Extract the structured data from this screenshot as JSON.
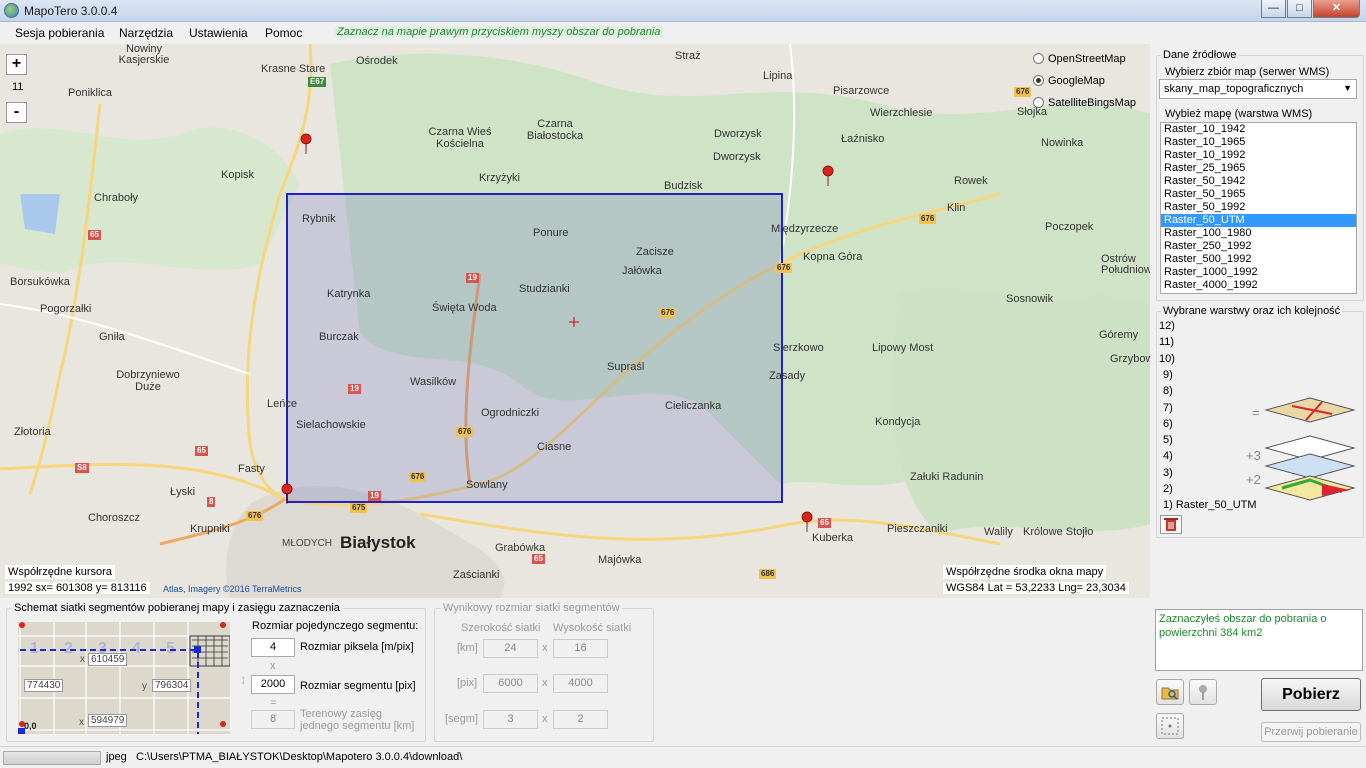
{
  "window": {
    "title": "MapoTero 3.0.0.4",
    "buttons": {
      "minimize": "—",
      "maximize": "□",
      "close": "✕"
    }
  },
  "menu": {
    "items": [
      "Sesja pobierania",
      "Narzędzia",
      "Ustawienia",
      "Pomoc"
    ],
    "hint": "Zaznacz na mapie  prawym  przyciskiem myszy obszar do pobrania"
  },
  "map": {
    "zoom_in": "+",
    "zoom_out": "-",
    "zoom_level": "11",
    "sources": [
      {
        "label": "OpenStreetMap",
        "selected": false
      },
      {
        "label": "GoogleMap",
        "selected": true
      },
      {
        "label": "SatelliteBingsMap",
        "selected": false
      }
    ],
    "places": [
      "Krasne Stare",
      "Ośrodek",
      "Straż",
      "Lipina",
      "Nowiny Kasjerskie",
      "Poniklica",
      "Czarna Wieś Kościelna",
      "Czarna Białostocka",
      "Dworzysk",
      "Dworzysk",
      "Pisarzowce",
      "Wierzchlesie",
      "Łaźnisko",
      "Nowinka",
      "Słojka",
      "Kopisk",
      "Krzyżyki",
      "Budzisk",
      "Rowek",
      "Chraboły",
      "Rybnik",
      "Ponure",
      "Zacisze",
      "Jałówka",
      "Międzyrzecze",
      "Klin",
      "Poczopek",
      "Borsukówka",
      "Katrynka",
      "Święta Woda",
      "Studzianki",
      "Kopna Góra",
      "Ostrów Południowy",
      "Pogorzałki",
      "Burczak",
      "Sosnowik",
      "Gniła",
      "Supraśl",
      "Sierzkowo",
      "Lipowy Most",
      "Góremy",
      "Grzybowe",
      "Dobrzyniewo Duże",
      "Wasilków",
      "Zasady",
      "Cieliczanka",
      "Leńce",
      "Ogrodniczki",
      "Kondycja",
      "Złotoria",
      "Sielachowskie",
      "Ciasne",
      "Fasty",
      "Sowlany",
      "Załuki Radunin",
      "Łyski",
      "Choroszcz",
      "Krupniki",
      "Pieszczaniki",
      "Walily",
      "Królowe Stojło",
      "Kuberka",
      "Grabówka",
      "Majówka",
      "Zaścianki"
    ],
    "city": "Białystok",
    "district": "MŁODYCH",
    "roads": [
      "E67",
      "65",
      "65",
      "S8",
      "8",
      "676",
      "19",
      "19",
      "676",
      "676",
      "676",
      "676",
      "19",
      "675",
      "65",
      "65",
      "686",
      "676",
      "676"
    ],
    "cursor_label": "Współrzędne kursora",
    "cursor_coords": "1992 sx= 601308   y= 813116",
    "attribution": "Atlas, Imagery ©2016 TerraMetrics",
    "center_label": "Współrzędne środka okna mapy",
    "center_coords": "WGS84  Lat = 53,2233  Lng= 23,3034"
  },
  "source_panel": {
    "group_label": "Dane źródłowe",
    "wms_label": "Wybierz zbiór map (serwer WMS)",
    "wms_value": "skany_map_topograficznych",
    "layer_label": "Wybież mapę (warstwa WMS)",
    "layers": [
      "Raster_10_1942",
      "Raster_10_1965",
      "Raster_10_1992",
      "Raster_25_1965",
      "Raster_50_1942",
      "Raster_50_1965",
      "Raster_50_1992",
      "Raster_50_UTM",
      "Raster_100_1980",
      "Raster_250_1992",
      "Raster_500_1992",
      "Raster_1000_1992",
      "Raster_4000_1992"
    ],
    "selected_layer_index": 7,
    "order_label": "Wybrane warstwy oraz ich kolejność",
    "order": [
      "12)",
      "11)",
      "10)",
      "9)",
      "8)",
      "7)",
      "6)",
      "5)",
      "4)",
      "3)",
      "2)",
      "1) Raster_50_UTM"
    ],
    "stack_marks": [
      "=",
      "+3",
      "+2"
    ]
  },
  "grid_scheme": {
    "label": "Schemat siatki segmentów pobieranej mapy i zasięgu zaznaczenia",
    "cells": [
      "1",
      "2",
      "3",
      "4",
      "5"
    ],
    "values": {
      "x_top": "610459",
      "y_left": "774430",
      "y_right": "796304",
      "x_bottom": "594979"
    },
    "axes": {
      "x": "x",
      "y": "y",
      "origin": "0,0"
    },
    "segment_heading": "Rozmiar pojedynczego segmentu:",
    "pixel_size": "4",
    "pixel_size_label": "Rozmiar piksela [m/pix]",
    "times": "x",
    "segment_size": "2000",
    "segment_size_label": "Rozmiar segmentu [pix]",
    "equals": "=",
    "segment_range": "8",
    "segment_range_label": "Terenowy zasięg jednego segmentu [km]"
  },
  "result_grid": {
    "label": "Wynikowy rozmiar siatki segmentów",
    "width_label": "Szerokość siatki",
    "height_label": "Wysokość siatki",
    "rows": [
      {
        "unit": "[km]",
        "width": "24",
        "height": "16"
      },
      {
        "unit": "[pix]",
        "width": "6000",
        "height": "4000"
      },
      {
        "unit": "[segm]",
        "width": "3",
        "height": "2"
      }
    ],
    "times": "x"
  },
  "message": "Zaznaczyłeś obszar do pobrania o powierzchni 384 km2",
  "actions": {
    "download": "Pobierz",
    "stop": "Przerwij pobieranie"
  },
  "status": {
    "format": "jpeg",
    "path": "C:\\Users\\PTMA_BIAŁYSTOK\\Desktop\\Mapotero 3.0.0.4\\download\\"
  }
}
